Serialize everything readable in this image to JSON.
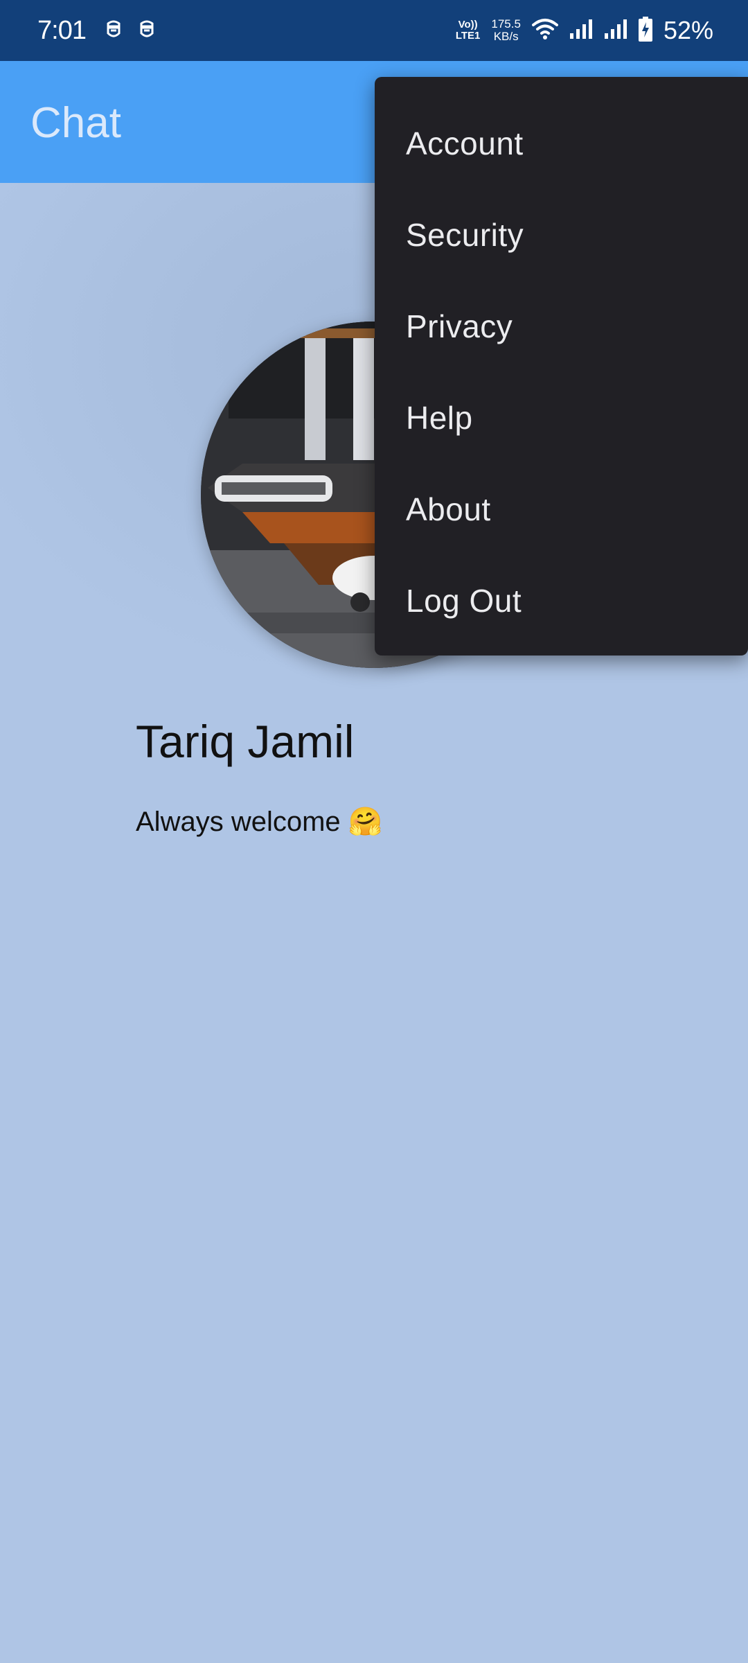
{
  "status_bar": {
    "time": "7:01",
    "notification_icons": [
      "app-notification-icon",
      "app-notification-icon"
    ],
    "volte": "Vo))",
    "lte": "LTE1",
    "net_speed_value": "175.5",
    "net_speed_unit": "KB/s",
    "battery": "52%"
  },
  "app_bar": {
    "title": "Chat"
  },
  "profile": {
    "name": "Tariq Jamil",
    "status": "Always welcome 🤗"
  },
  "menu": {
    "items": [
      {
        "label": "Account"
      },
      {
        "label": "Security"
      },
      {
        "label": "Privacy"
      },
      {
        "label": "Help"
      },
      {
        "label": "About"
      },
      {
        "label": "Log Out"
      }
    ]
  },
  "colors": {
    "status_bar": "#12407a",
    "app_bar": "#4aa0f5",
    "background": "#afc5e5",
    "menu": "#212025"
  }
}
